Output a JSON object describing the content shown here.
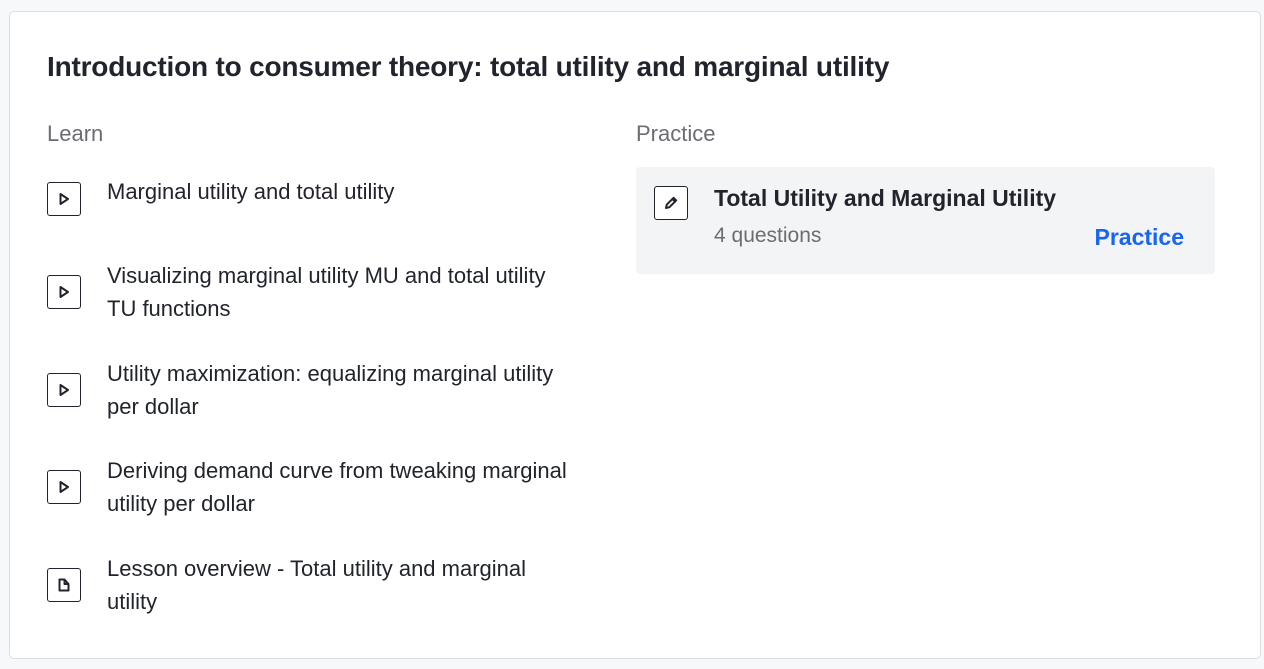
{
  "unit": {
    "title": "Introduction to consumer theory: total utility and marginal utility"
  },
  "learn": {
    "heading": "Learn",
    "items": [
      {
        "label": "Marginal utility and total utility",
        "icon": "play-icon"
      },
      {
        "label": "Visualizing marginal utility MU and total utility TU functions",
        "icon": "play-icon"
      },
      {
        "label": "Utility maximization: equalizing marginal utility per dollar",
        "icon": "play-icon"
      },
      {
        "label": "Deriving demand curve from tweaking marginal utility per dollar",
        "icon": "play-icon"
      },
      {
        "label": "Lesson overview - Total utility and marginal utility",
        "icon": "article-icon"
      }
    ]
  },
  "practice": {
    "heading": "Practice",
    "exercise": {
      "title": "Total Utility and Marginal Utility",
      "subtitle": "4 questions",
      "action_label": "Practice",
      "icon": "pencil-icon"
    }
  },
  "colors": {
    "accent": "#1865f2",
    "text": "#21242c",
    "muted": "#6b6d73",
    "card_bg": "#f3f4f6"
  }
}
